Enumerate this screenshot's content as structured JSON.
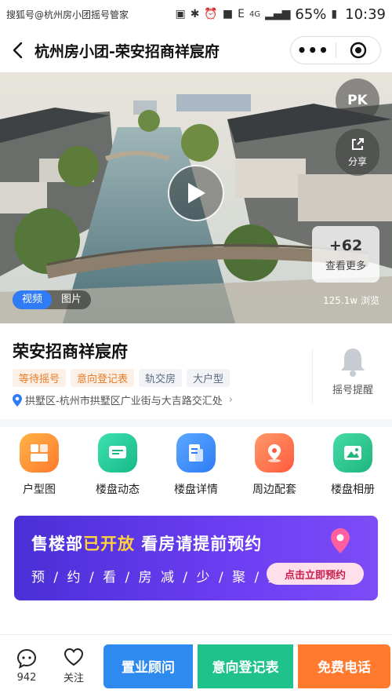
{
  "status_bar": {
    "watermark": "搜狐号@杭州房小团摇号管家",
    "network": "4G",
    "battery": "65%",
    "time": "10:39"
  },
  "nav": {
    "title": "杭州房小团-荣安招商祥宸府",
    "more_label": "•••"
  },
  "hero": {
    "pk_label": "PK",
    "share_label": "分享",
    "more_count": "+62",
    "more_label": "查看更多",
    "tabs": [
      "视频",
      "图片"
    ],
    "active_tab": 0,
    "views": "125.1w 浏览"
  },
  "project": {
    "name": "荣安招商祥宸府",
    "tags": [
      {
        "label": "等待摇号",
        "style": "orange"
      },
      {
        "label": "意向登记表",
        "style": "orange"
      },
      {
        "label": "轨交房",
        "style": "gray"
      },
      {
        "label": "大户型",
        "style": "gray"
      }
    ],
    "address": "拱墅区-杭州市拱墅区广业街与大吉路交汇处",
    "remind_label": "摇号提醒"
  },
  "features": [
    {
      "label": "户型图",
      "icon": "floorplan-icon",
      "color": "#ff8a3c"
    },
    {
      "label": "楼盘动态",
      "icon": "news-icon",
      "color": "#22c39a"
    },
    {
      "label": "楼盘详情",
      "icon": "details-icon",
      "color": "#3a8cf5"
    },
    {
      "label": "周边配套",
      "icon": "location-icon",
      "color": "#ff6a4a"
    },
    {
      "label": "楼盘相册",
      "icon": "album-icon",
      "color": "#26c08a"
    }
  ],
  "banner": {
    "line1_a": "售楼部",
    "line1_hl": "已开放",
    "line1_b": " 看房请提前预约",
    "line2": "预 / 约 / 看 / 房   减 / 少 / 聚 / 集",
    "cta": "点击立即预约"
  },
  "bottom_bar": {
    "comments_count": "942",
    "follow_label": "关注",
    "buttons": [
      "置业顾问",
      "意向登记表",
      "免费电话"
    ]
  }
}
